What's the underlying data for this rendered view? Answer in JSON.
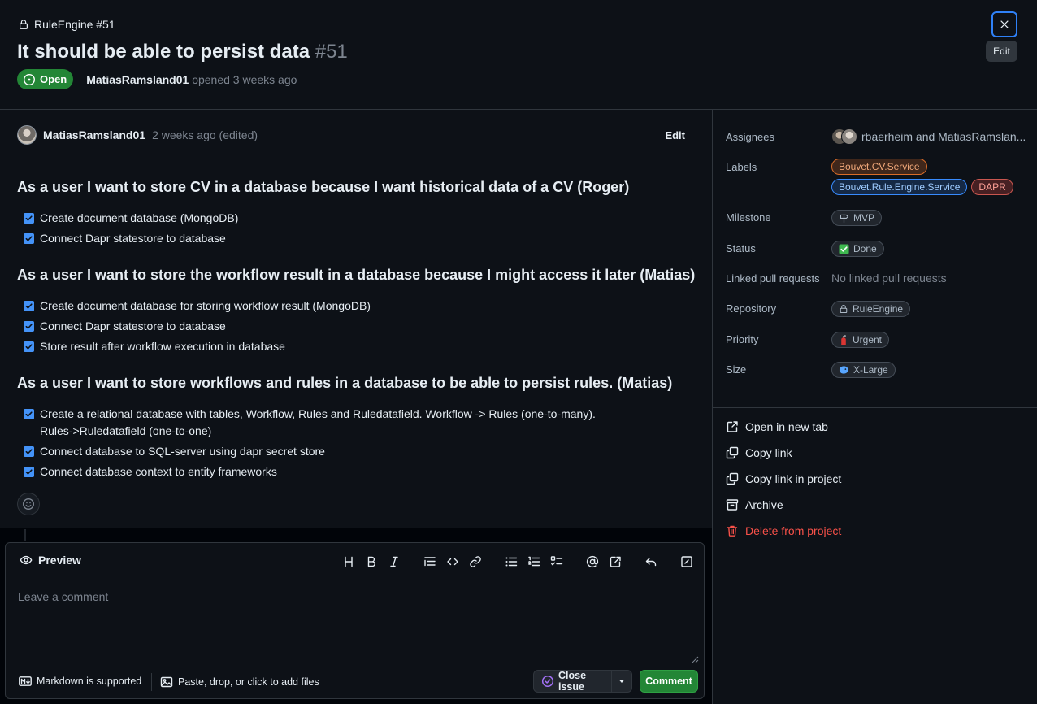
{
  "header": {
    "repo_ref": "RuleEngine #51",
    "title": "It should be able to persist data",
    "number": "#51",
    "state": "Open",
    "author": "MatiasRamsland01",
    "opened_text": "opened 3 weeks ago",
    "close_tooltip": "Edit"
  },
  "comment": {
    "author": "MatiasRamsland01",
    "time": "2 weeks ago (edited)",
    "edit_label": "Edit",
    "sections": [
      {
        "heading": "As a user I want to store CV in a database because I want historical data of a CV (Roger)",
        "tasks": [
          "Create document database (MongoDB)",
          "Connect Dapr statestore to database"
        ]
      },
      {
        "heading": "As a user I want to store the workflow result in a database because I might access it later (Matias)",
        "tasks": [
          "Create document database for storing workflow result (MongoDB)",
          "Connect Dapr statestore to database",
          "Store result after workflow execution in database"
        ]
      },
      {
        "heading": "As a user I want to store workflows and rules in a database to be able to persist rules. (Matias)",
        "tasks": [
          "Create a relational database with tables, Workflow, Rules and Ruledatafield. Workflow -> Rules (one-to-many).",
          "Rules->Ruledatafield (one-to-one)",
          "Connect database to SQL-server using dapr secret store",
          "Connect database context to entity frameworks"
        ]
      }
    ]
  },
  "editor": {
    "preview_tab": "Preview",
    "placeholder": "Leave a comment",
    "markdown_note": "Markdown is supported",
    "files_note": "Paste, drop, or click to add files",
    "close_issue": "Close issue",
    "comment_button": "Comment"
  },
  "sidebar": {
    "assignees_label": "Assignees",
    "assignees_value": "rbaerheim and MatiasRamslan...",
    "labels_label": "Labels",
    "labels": [
      "Bouvet.CV.Service",
      "Bouvet.Rule.Engine.Service",
      "DAPR"
    ],
    "milestone_label": "Milestone",
    "milestone_value": "MVP",
    "status_label": "Status",
    "status_value": "Done",
    "linked_label": "Linked pull requests",
    "linked_value": "No linked pull requests",
    "repository_label": "Repository",
    "repository_value": "RuleEngine",
    "priority_label": "Priority",
    "priority_value": "Urgent",
    "size_label": "Size",
    "size_value": "X-Large",
    "actions": {
      "open_new_tab": "Open in new tab",
      "copy_link": "Copy link",
      "copy_link_project": "Copy link in project",
      "archive": "Archive",
      "delete": "Delete from project"
    }
  },
  "colors": {
    "accent": "#2f81f7",
    "open_green": "#238636",
    "danger": "#f85149",
    "checkbox": "#4493f8"
  }
}
